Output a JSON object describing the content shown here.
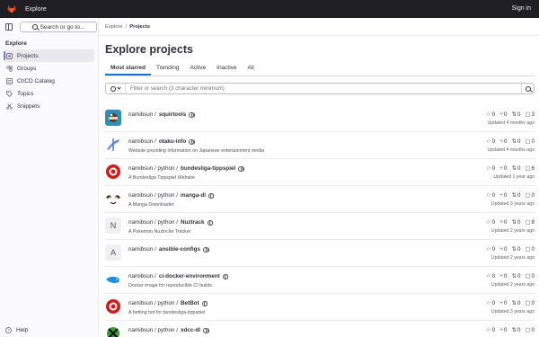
{
  "topbar": {
    "title": "Explore",
    "signin": "Sign in",
    "brand_color": "#e24329"
  },
  "sidebar": {
    "search_label": "Search or go to...",
    "heading": "Explore",
    "items": [
      {
        "label": "Projects",
        "icon": "project-icon",
        "active": true
      },
      {
        "label": "Groups",
        "icon": "group-icon"
      },
      {
        "label": "CI/CD Catalog",
        "icon": "catalog-icon"
      },
      {
        "label": "Topics",
        "icon": "label-icon"
      },
      {
        "label": "Snippets",
        "icon": "snippet-icon"
      }
    ],
    "help": "Help"
  },
  "breadcrumb": {
    "parent": "Explore",
    "current": "Projects"
  },
  "page_title": "Explore projects",
  "tabs": [
    "Most starred",
    "Trending",
    "Active",
    "Inactive",
    "All"
  ],
  "filter": {
    "placeholder": "Filter or search (3 character minimum)"
  },
  "projects": [
    {
      "namespace": "namibsun / ",
      "name": "squirtools",
      "desc": "",
      "stars": "0",
      "forks": "0",
      "mrs": "0",
      "issues": "3",
      "updated": "Updated 4 months ago"
    },
    {
      "namespace": "namibsun / ",
      "name": "otaku-info",
      "desc": "Website providing information on Japanese entertainment media",
      "stars": "0",
      "forks": "0",
      "mrs": "0",
      "issues": "0",
      "updated": "Updated 4 months ago"
    },
    {
      "namespace": "namibsun / python / ",
      "name": "bundesliga-tippspiel",
      "desc": "A Bundesliga Tippspiel Website",
      "stars": "0",
      "forks": "0",
      "mrs": "0",
      "issues": "6",
      "updated": "Updated 1 year ago"
    },
    {
      "namespace": "namibsun / python / ",
      "name": "manga-dl",
      "desc": "A Manga Downloader",
      "stars": "0",
      "forks": "0",
      "mrs": "0",
      "issues": "0",
      "updated": "Updated 3 years ago"
    },
    {
      "namespace": "namibsun / python / ",
      "name": "Nuztrack",
      "desc": "A Pokemon Nuzlocke Tracker",
      "stars": "0",
      "forks": "0",
      "mrs": "0",
      "issues": "8",
      "updated": "Updated 2 years ago",
      "letter": "N"
    },
    {
      "namespace": "namibsun / ",
      "name": "ansible-configs",
      "desc": "",
      "stars": "0",
      "forks": "0",
      "mrs": "0",
      "issues": "0",
      "updated": "Updated 2 years ago",
      "letter": "A"
    },
    {
      "namespace": "namibsun / ",
      "name": "ci-docker-environment",
      "desc": "Docker image for reproducible CI builds",
      "stars": "0",
      "forks": "0",
      "mrs": "0",
      "issues": "0",
      "updated": "Updated 2 years ago"
    },
    {
      "namespace": "namibsun / python / ",
      "name": "BetBot",
      "desc": "A betting bot for bundesliga-tippspiel",
      "stars": "0",
      "forks": "0",
      "mrs": "0",
      "issues": "0",
      "updated": "Updated 3 years ago"
    },
    {
      "namespace": "namibsun / python / ",
      "name": "xdcc-dl",
      "desc": "",
      "stars": "0",
      "forks": "0",
      "mrs": "0",
      "issues": "0",
      "updated": ""
    }
  ]
}
